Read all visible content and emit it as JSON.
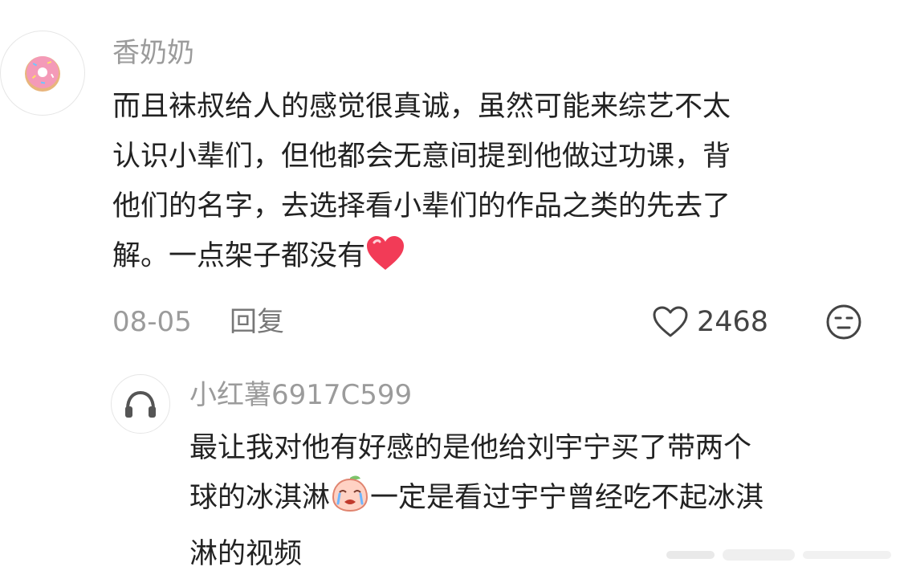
{
  "comment": {
    "username": "香奶奶",
    "avatar_icon": "donut-icon",
    "lines": [
      "而且袜叔给人的感觉很真诚，虽然可能来综艺不太",
      "认识小辈们，但他都会无意间提到他做过功课，背",
      "他们的名字，去选择看小辈们的作品之类的先去了",
      "解。一点架子都没有"
    ],
    "end_emoji": "red-heart-icon",
    "date": "08-05",
    "reply_label": "回复",
    "like_icon": "heart-outline-icon",
    "like_count": "2468",
    "dislike_icon": "unamused-face-icon"
  },
  "reply": {
    "username": "小红薯6917C599",
    "avatar_icon": "headphones-icon",
    "lines": [
      "最让我对他有好感的是他给刘宇宁买了带两个",
      "一定是看过宇宁曾经吃不起冰淇",
      "淋的视频"
    ],
    "line2_prefix": "球的冰淇淋",
    "inline_emoji": "crying-peach-icon"
  },
  "colors": {
    "text": "#222222",
    "secondary": "#9b9b9b",
    "heart": "#f23b57",
    "background": "#ffffff"
  }
}
